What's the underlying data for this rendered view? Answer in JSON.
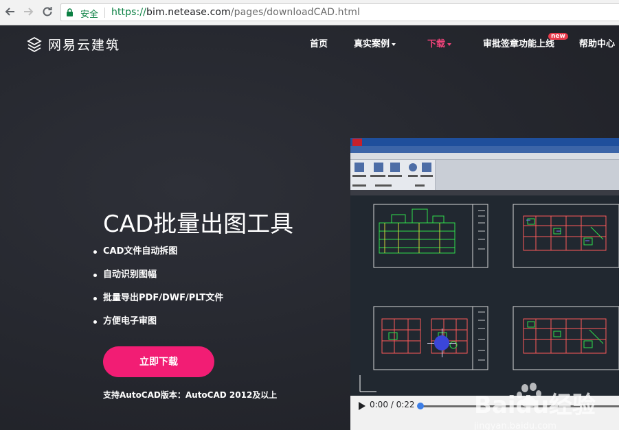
{
  "browser": {
    "secure_label": "安全",
    "url_protocol": "https://",
    "url_host": "bim.netease.com",
    "url_path": "/pages/downloadCAD.html"
  },
  "site": {
    "logo_text": "网易云建筑",
    "nav": [
      {
        "label": "首页",
        "dropdown": false,
        "active": false
      },
      {
        "label": "真实案例",
        "dropdown": true,
        "active": false
      },
      {
        "label": "下载",
        "dropdown": true,
        "active": true
      },
      {
        "label": "审批签章功能上线",
        "dropdown": false,
        "active": false
      },
      {
        "label": "帮助中心",
        "dropdown": false,
        "active": false
      }
    ],
    "new_badge": "new"
  },
  "hero": {
    "title": "CAD批量出图工具",
    "features": [
      "CAD文件自动拆图",
      "自动识别图幅",
      "批量导出PDF/DWF/PLT文件",
      "方便电子审图"
    ],
    "download_label": "立即下载",
    "support_note": "支持AutoCAD版本：AutoCAD 2012及以上"
  },
  "video": {
    "time": "0:00 / 0:22",
    "progress": 0
  },
  "watermark": {
    "brand": "Baidu经验",
    "url": "jingyan.baidu.com"
  },
  "colors": {
    "accent": "#f21d74",
    "nav_active": "#f0437a",
    "secure_green": "#0b8043",
    "badge_red": "#e83b4b",
    "seek_blue": "#3d7ee6"
  },
  "icons": {
    "back": "arrow-left-icon",
    "forward": "arrow-right-icon",
    "reload": "reload-icon",
    "lock": "lock-icon",
    "play": "play-icon",
    "logo": "netease-building-logo-icon"
  }
}
